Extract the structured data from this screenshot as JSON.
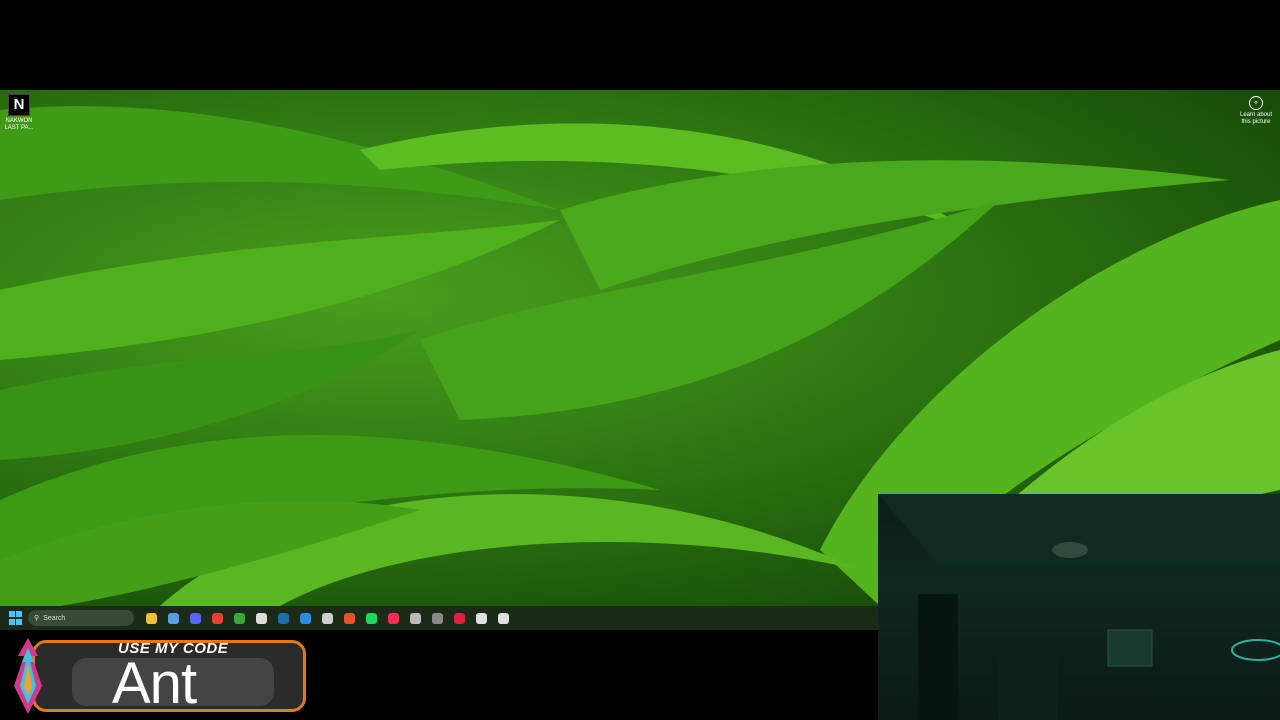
{
  "desktop": {
    "icons": [
      {
        "label": "NAKWON LAST PA...",
        "glyph": "N"
      }
    ],
    "spotlight": {
      "label": "Learn about this picture",
      "icon": "camera-icon"
    }
  },
  "taskbar": {
    "search_placeholder": "Search",
    "apps": [
      {
        "name": "file-explorer",
        "color": "#f0c040"
      },
      {
        "name": "photos",
        "color": "#5aa0e8"
      },
      {
        "name": "discord",
        "color": "#5865f2"
      },
      {
        "name": "chrome",
        "color": "#e34133"
      },
      {
        "name": "xbox",
        "color": "#3fa33f"
      },
      {
        "name": "epic-games",
        "color": "#dddddd"
      },
      {
        "name": "steam",
        "color": "#1b6ea8"
      },
      {
        "name": "battle-net",
        "color": "#2a8de6"
      },
      {
        "name": "obs",
        "color": "#cfcfcf"
      },
      {
        "name": "brave",
        "color": "#e5532d"
      },
      {
        "name": "spotify",
        "color": "#1ed760"
      },
      {
        "name": "tiktok",
        "color": "#ff2d55"
      },
      {
        "name": "app-red-badge",
        "color": "#bbbbbb"
      },
      {
        "name": "app-pill",
        "color": "#8a8a8a"
      },
      {
        "name": "app-red-circle",
        "color": "#e0203c"
      },
      {
        "name": "settings",
        "color": "#e0e0e0"
      },
      {
        "name": "app-gear",
        "color": "#e0e0e0"
      }
    ]
  },
  "promo": {
    "line1": "USE MY CODE",
    "line2": "Ant"
  }
}
